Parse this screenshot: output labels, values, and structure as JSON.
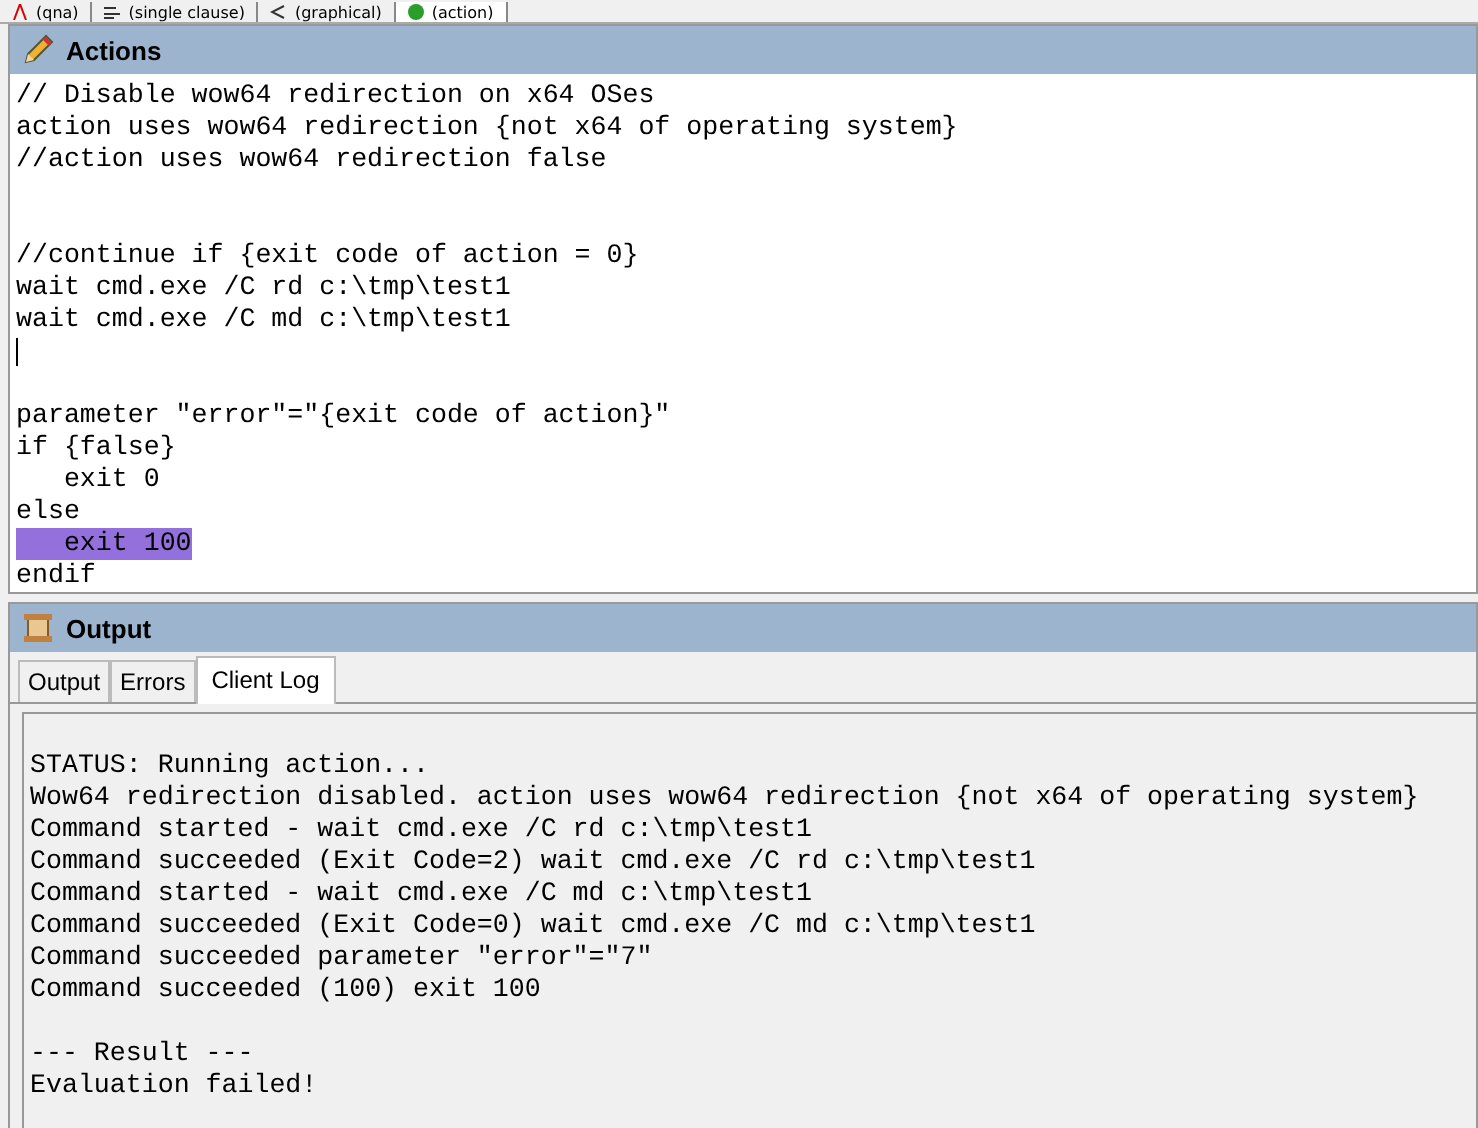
{
  "top_tabs": [
    {
      "label": "(qna)",
      "kind": "qna",
      "selected": false
    },
    {
      "label": "(single clause)",
      "kind": "clause",
      "selected": false
    },
    {
      "label": "(graphical)",
      "kind": "graphical",
      "selected": false
    },
    {
      "label": "(action)",
      "kind": "action",
      "selected": true
    }
  ],
  "actions_panel": {
    "title": "Actions",
    "lines": [
      {
        "kind": "code",
        "text": "// Disable wow64 redirection on x64 OSes",
        "highlighted": false
      },
      {
        "kind": "code",
        "text": "action uses wow64 redirection {not x64 of operating system}",
        "highlighted": false
      },
      {
        "kind": "code",
        "text": "//action uses wow64 redirection false",
        "highlighted": false
      },
      {
        "kind": "blank"
      },
      {
        "kind": "blank"
      },
      {
        "kind": "code",
        "text": "//continue if {exit code of action = 0}",
        "highlighted": false
      },
      {
        "kind": "code",
        "text": "wait cmd.exe /C rd c:\\tmp\\test1",
        "highlighted": false
      },
      {
        "kind": "code",
        "text": "wait cmd.exe /C md c:\\tmp\\test1",
        "highlighted": false
      },
      {
        "kind": "cursor"
      },
      {
        "kind": "blank"
      },
      {
        "kind": "code",
        "text": "parameter \"error\"=\"{exit code of action}\"",
        "highlighted": false
      },
      {
        "kind": "code",
        "text": "if {false}",
        "highlighted": false
      },
      {
        "kind": "code",
        "text": "   exit 0",
        "highlighted": false
      },
      {
        "kind": "code",
        "text": "else",
        "highlighted": false
      },
      {
        "kind": "code",
        "text": "   exit 100",
        "highlighted": true
      },
      {
        "kind": "code",
        "text": "endif",
        "highlighted": false
      }
    ]
  },
  "output_panel": {
    "title": "Output",
    "tabs": [
      {
        "label": "Output",
        "selected": false
      },
      {
        "label": "Errors",
        "selected": false
      },
      {
        "label": "Client Log",
        "selected": true
      }
    ],
    "log_lines": [
      {
        "kind": "blank"
      },
      {
        "kind": "text",
        "text": "STATUS: Running action..."
      },
      {
        "kind": "text",
        "text": "Wow64 redirection disabled. action uses wow64 redirection {not x64 of operating system}"
      },
      {
        "kind": "text",
        "text": "Command started - wait cmd.exe /C rd c:\\tmp\\test1"
      },
      {
        "kind": "text",
        "text": "Command succeeded (Exit Code=2) wait cmd.exe /C rd c:\\tmp\\test1"
      },
      {
        "kind": "text",
        "text": "Command started - wait cmd.exe /C md c:\\tmp\\test1"
      },
      {
        "kind": "text",
        "text": "Command succeeded (Exit Code=0) wait cmd.exe /C md c:\\tmp\\test1"
      },
      {
        "kind": "text",
        "text": "Command succeeded parameter \"error\"=\"7\""
      },
      {
        "kind": "text",
        "text": "Command succeeded (100) exit 100"
      },
      {
        "kind": "blank"
      },
      {
        "kind": "text",
        "text": "--- Result ---"
      },
      {
        "kind": "text",
        "text": "Evaluation failed!"
      }
    ]
  }
}
